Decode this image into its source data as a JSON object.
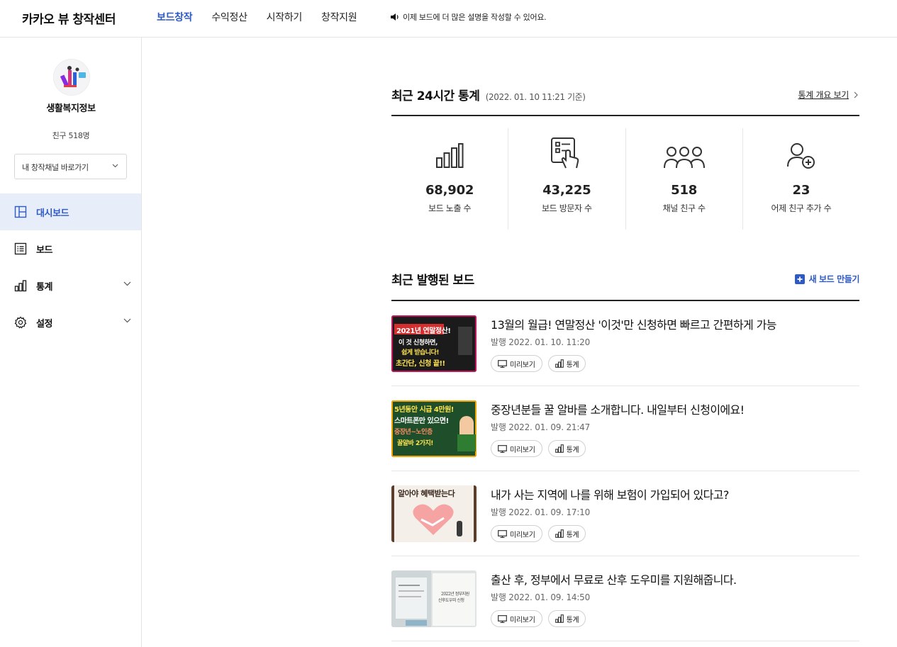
{
  "header": {
    "logo": "카카오 뷰 창작센터",
    "nav": [
      "보드창작",
      "수익정산",
      "시작하기",
      "창작지원"
    ],
    "active_nav": "보드창작",
    "notice": "이제 보드에 더 많은 설명을 작성할 수 있어요."
  },
  "sidebar": {
    "channel_name": "생활복지정보",
    "friends": "친구 518명",
    "channel_select": "내 창작채널 바로가기",
    "menu": [
      {
        "label": "대시보드",
        "icon": "dashboard-icon",
        "active": true
      },
      {
        "label": "보드",
        "icon": "board-list-icon"
      },
      {
        "label": "통계",
        "icon": "stats-icon",
        "expandable": true
      },
      {
        "label": "설정",
        "icon": "settings-icon",
        "expandable": true
      }
    ]
  },
  "stats": {
    "title": "최근 24시간 통계",
    "date": "(2022. 01. 10 11:21 기준)",
    "link": "통계 개요 보기",
    "items": [
      {
        "value": "68,902",
        "label": "보드 노출 수",
        "icon": "bar-chart-icon"
      },
      {
        "value": "43,225",
        "label": "보드 방문자 수",
        "icon": "tap-card-icon"
      },
      {
        "value": "518",
        "label": "채널 친구 수",
        "icon": "group-icon"
      },
      {
        "value": "23",
        "label": "어제 친구 추가 수",
        "icon": "add-friend-icon"
      }
    ]
  },
  "boards": {
    "title": "최근 발행된 보드",
    "new_board": "새 보드 만들기",
    "preview_label": "미리보기",
    "stats_label": "통계",
    "items": [
      {
        "title": "13월의 월급! 연말정산 '이것'만 신청하면 빠르고 간편하게 가능",
        "date": "발행 2022. 01. 10. 11:20",
        "thumb_lines": [
          "2021년 연말정산!",
          "이 것 신청하면,",
          "쉽게 받습니다!",
          "초간단, 신청 끝!!"
        ]
      },
      {
        "title": "중장년분들 꿀 알바를 소개합니다. 내일부터 신청이에요!",
        "date": "발행 2022. 01. 09. 21:47",
        "thumb_lines": [
          "5년동안 시급 4만원!",
          "스마트폰만 있으면!",
          "중장년~노인층",
          "꿀알바 2가지!"
        ]
      },
      {
        "title": "내가 사는 지역에 나를 위해 보험이 가입되어 있다고?",
        "date": "발행 2022. 01. 09. 17:10",
        "thumb_lines": [
          "알아야 혜택받는다"
        ]
      },
      {
        "title": "출산 후, 정부에서 무료로 산후 도우미를 지원해줍니다.",
        "date": "발행 2022. 01. 09. 14:50",
        "thumb_lines": [
          "2022년 정부지원",
          "산후도우미 신청"
        ]
      }
    ]
  },
  "colors": {
    "accent": "#2d5ac8",
    "active_menu_bg": "#e8eef9"
  }
}
